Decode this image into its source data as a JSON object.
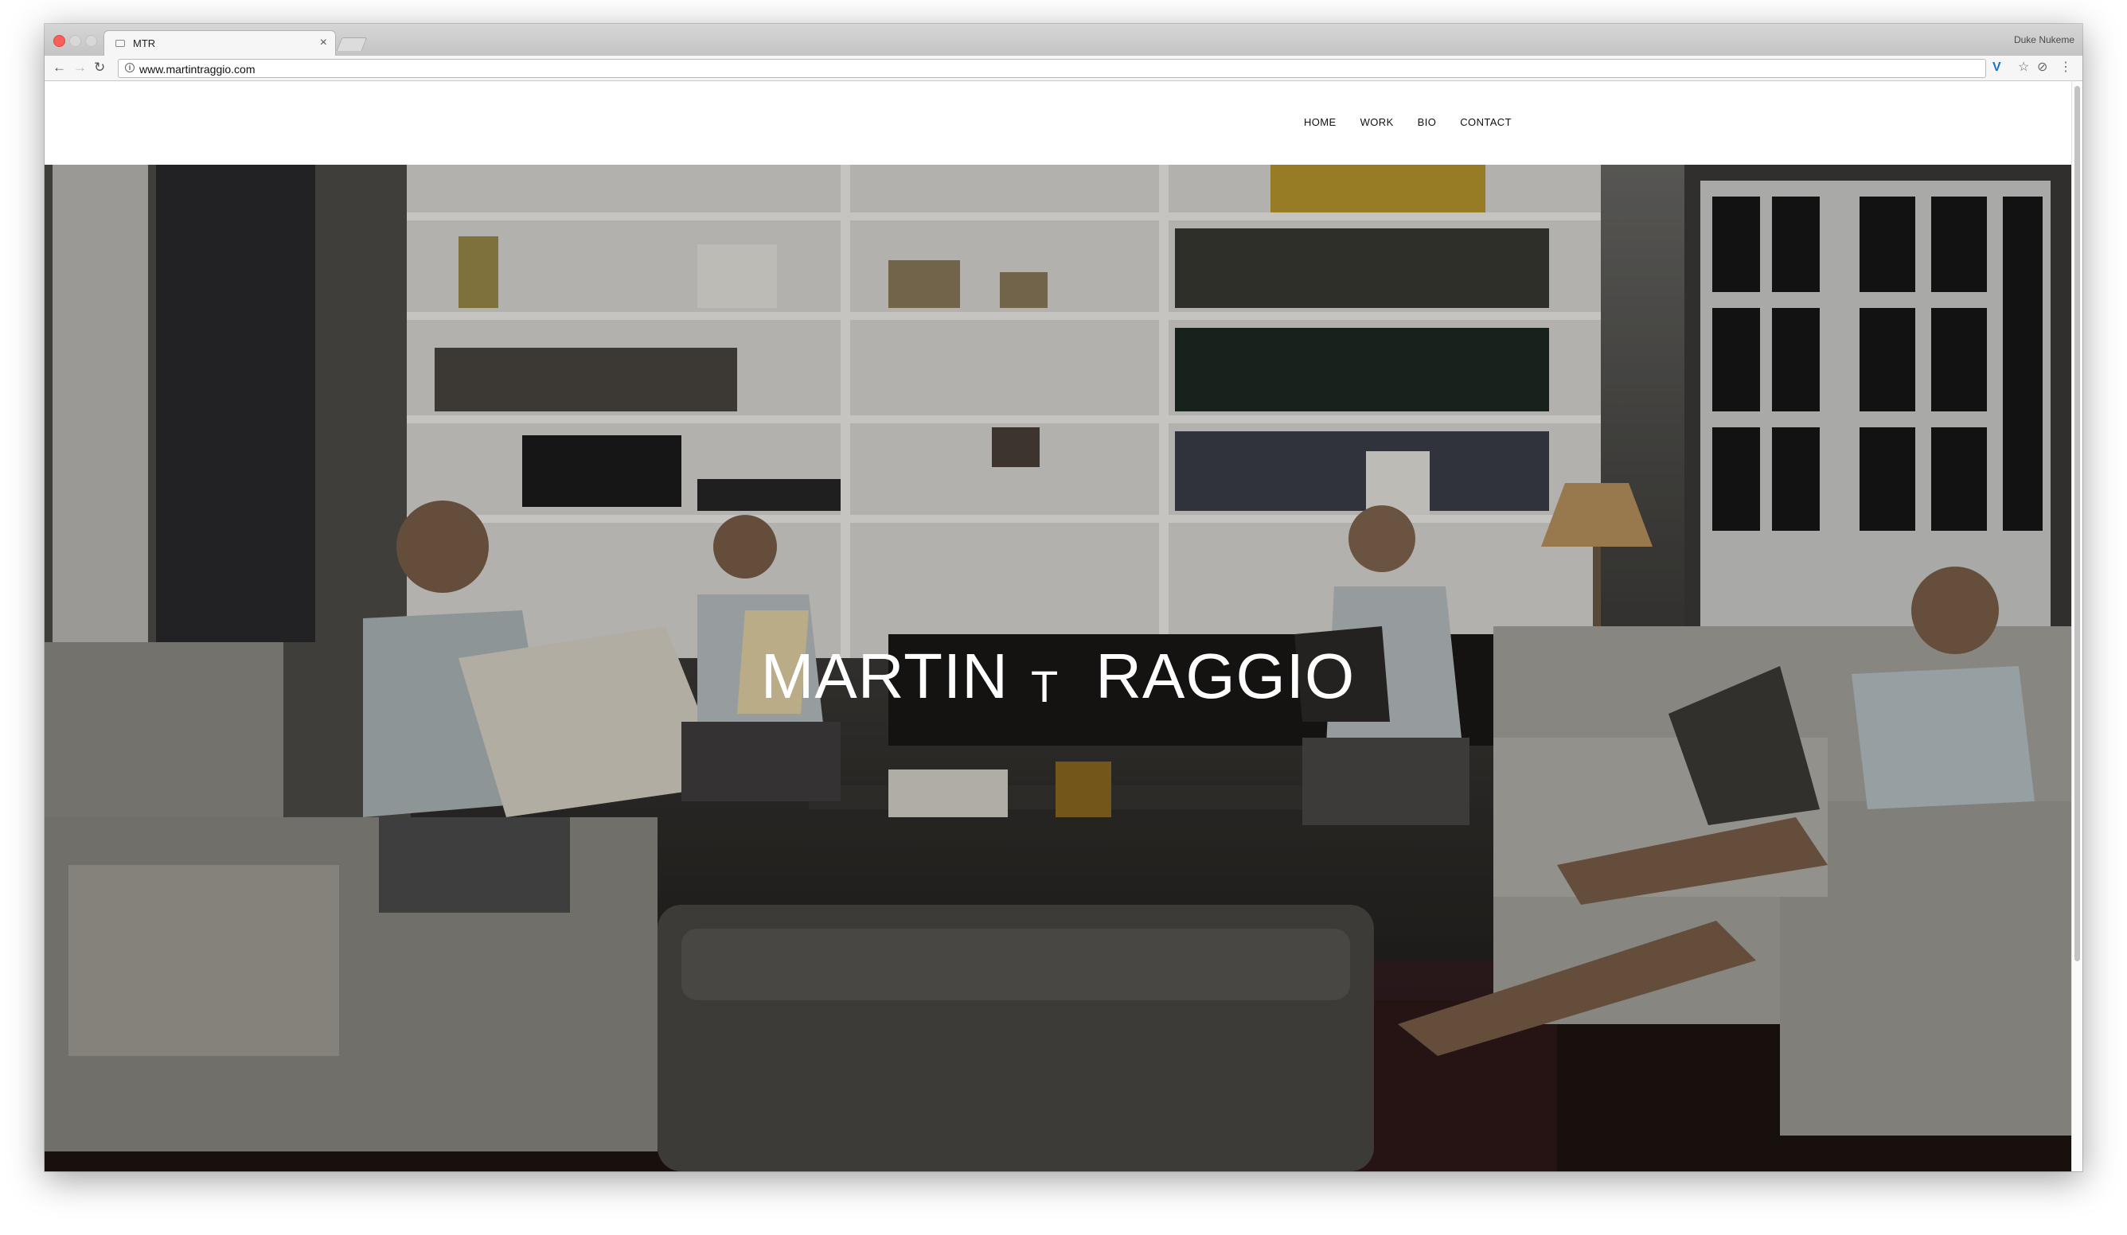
{
  "browser": {
    "tab_title": "MTR",
    "profile_name": "Duke Nukeme",
    "url": "www.martintraggio.com",
    "colors": {
      "close": "#fc5f57",
      "inactive_light": "#d8d8d8"
    }
  },
  "site": {
    "nav": [
      "HOME",
      "WORK",
      "BIO",
      "CONTACT"
    ],
    "hero": {
      "title_left": "MARTIN",
      "title_middle": "T",
      "title_right": "RAGGIO",
      "image": "dim living room with a boy reading newspapers and magazines on sofas and chairs in front of bookshelves, four times"
    }
  }
}
